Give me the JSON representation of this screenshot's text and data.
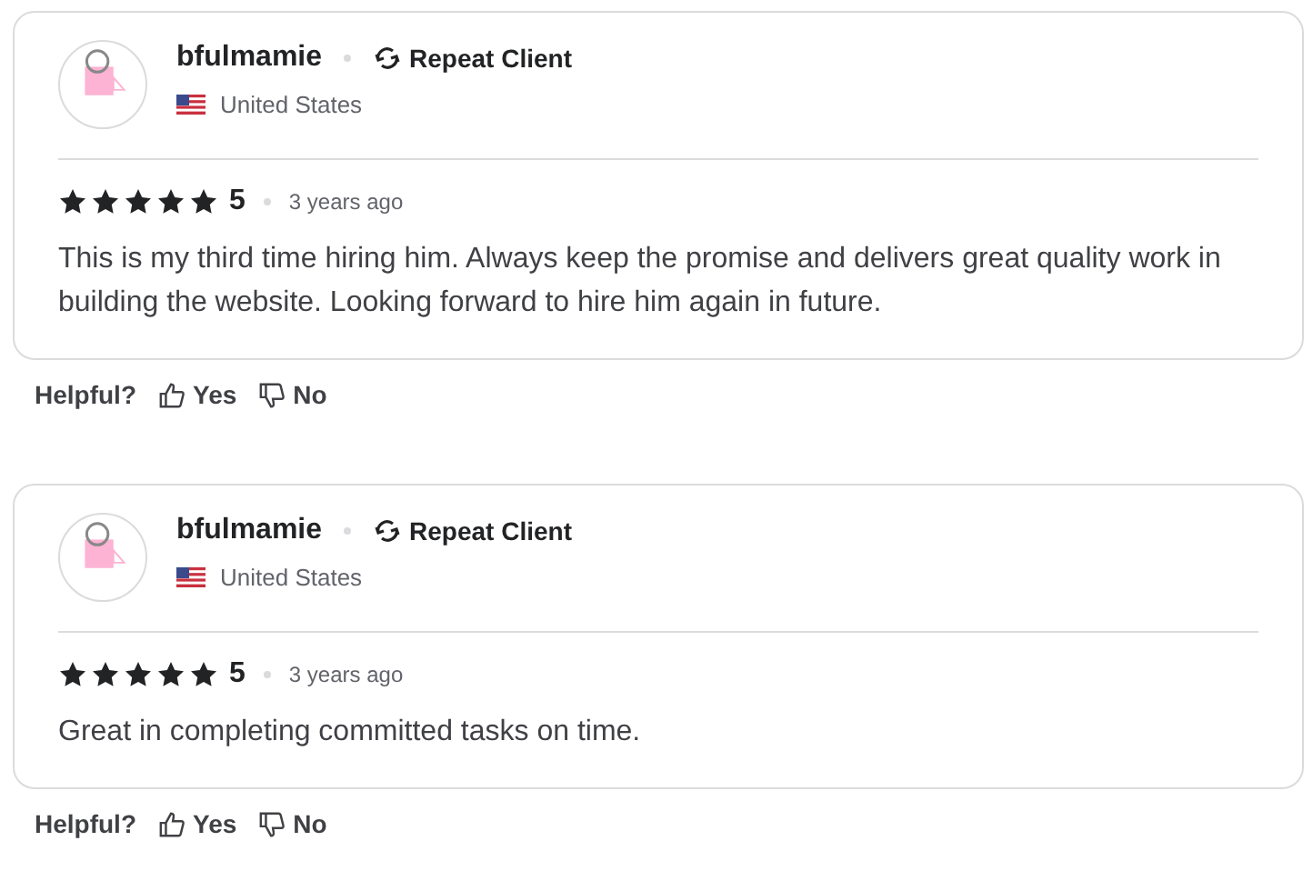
{
  "reviews": [
    {
      "name": "bfulmamie",
      "badge": "Repeat Client",
      "country": "United States",
      "stars": 5,
      "rating": "5",
      "time": "3 years ago",
      "text": "This is my third time hiring him. Always keep the promise and delivers great quality work in building the website. Looking forward to hire him again in future.",
      "helpful": {
        "label": "Helpful?",
        "yes": "Yes",
        "no": "No"
      }
    },
    {
      "name": "bfulmamie",
      "badge": "Repeat Client",
      "country": "United States",
      "stars": 5,
      "rating": "5",
      "time": "3 years ago",
      "text": "Great in completing committed tasks on time.",
      "helpful": {
        "label": "Helpful?",
        "yes": "Yes",
        "no": "No"
      }
    }
  ]
}
